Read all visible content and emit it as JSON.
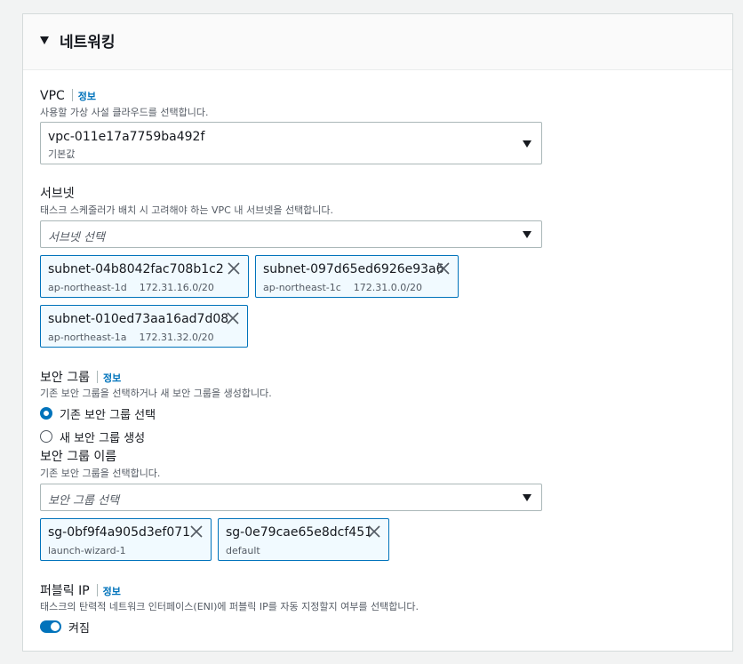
{
  "section": {
    "title": "네트워킹"
  },
  "vpc": {
    "label": "VPC",
    "info": "정보",
    "description": "사용할 가상 사설 클라우드를 선택합니다.",
    "selected_value": "vpc-011e17a7759ba492f",
    "selected_sub": "기본값"
  },
  "subnet": {
    "label": "서브넷",
    "description": "태스크 스케줄러가 배치 시 고려해야 하는 VPC 내 서브넷을 선택합니다.",
    "placeholder": "서브넷 선택",
    "tokens": [
      {
        "id": "subnet-04b8042fac708b1c2",
        "az": "ap-northeast-1d",
        "cidr": "172.31.16.0/20"
      },
      {
        "id": "subnet-097d65ed6926e93a6",
        "az": "ap-northeast-1c",
        "cidr": "172.31.0.0/20"
      },
      {
        "id": "subnet-010ed73aa16ad7d08",
        "az": "ap-northeast-1a",
        "cidr": "172.31.32.0/20"
      }
    ]
  },
  "security_group": {
    "label": "보안 그룹",
    "info": "정보",
    "description": "기존 보안 그룹을 선택하거나 새 보안 그룹을 생성합니다.",
    "options": [
      {
        "label": "기존 보안 그룹 선택",
        "selected": true
      },
      {
        "label": "새 보안 그룹 생성",
        "selected": false
      }
    ],
    "name_label": "보안 그룹 이름",
    "name_description": "기존 보안 그룹을 선택합니다.",
    "placeholder": "보안 그룹 선택",
    "tokens": [
      {
        "id": "sg-0bf9f4a905d3ef071",
        "name": "launch-wizard-1"
      },
      {
        "id": "sg-0e79cae65e8dcf451",
        "name": "default"
      }
    ]
  },
  "public_ip": {
    "label": "퍼블릭 IP",
    "info": "정보",
    "description": "태스크의 탄력적 네트워크 인터페이스(ENI)에 퍼블릭 IP를 자동 지정할지 여부를 선택합니다.",
    "toggle_label": "켜짐",
    "enabled": true
  },
  "colors": {
    "accent": "#0073bb",
    "token_bg": "#f1faff",
    "border": "#aab7b8"
  },
  "icons": [
    "caret-down-icon",
    "dropdown-arrow-icon",
    "close-icon",
    "toggle-switch"
  ]
}
